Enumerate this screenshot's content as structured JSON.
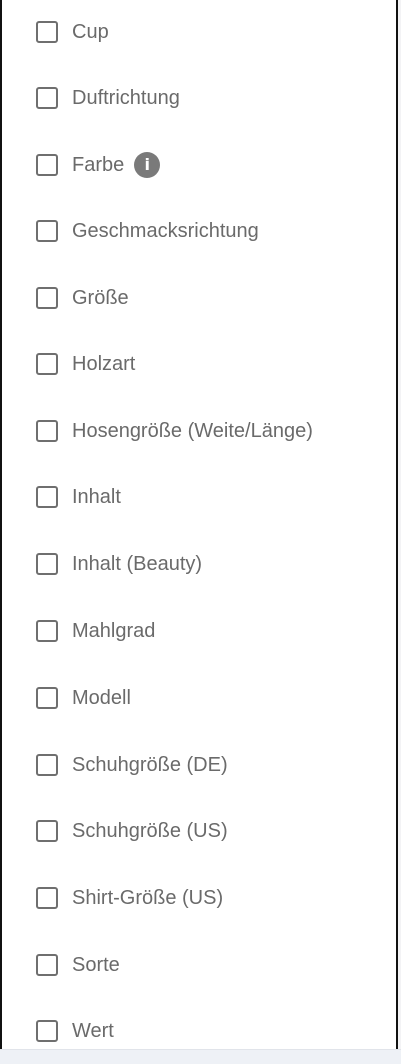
{
  "filters": [
    {
      "label": "Cup",
      "info": false
    },
    {
      "label": "Duftrichtung",
      "info": false
    },
    {
      "label": "Farbe",
      "info": true
    },
    {
      "label": "Geschmacksrichtung",
      "info": false
    },
    {
      "label": "Größe",
      "info": false
    },
    {
      "label": "Holzart",
      "info": false
    },
    {
      "label": "Hosengröße (Weite/Länge)",
      "info": false
    },
    {
      "label": "Inhalt",
      "info": false
    },
    {
      "label": "Inhalt (Beauty)",
      "info": false
    },
    {
      "label": "Mahlgrad",
      "info": false
    },
    {
      "label": "Modell",
      "info": false
    },
    {
      "label": "Schuhgröße (DE)",
      "info": false
    },
    {
      "label": "Schuhgröße (US)",
      "info": false
    },
    {
      "label": "Shirt-Größe (US)",
      "info": false
    },
    {
      "label": "Sorte",
      "info": false
    },
    {
      "label": "Wert",
      "info": false
    }
  ],
  "info_icon": {
    "name": "info-icon",
    "glyph": "i"
  },
  "colors": {
    "text": "#6a6a6a",
    "checkbox_border": "#6f6f6f",
    "info_bg": "#7a7a7a",
    "frame_border": "#111111"
  }
}
